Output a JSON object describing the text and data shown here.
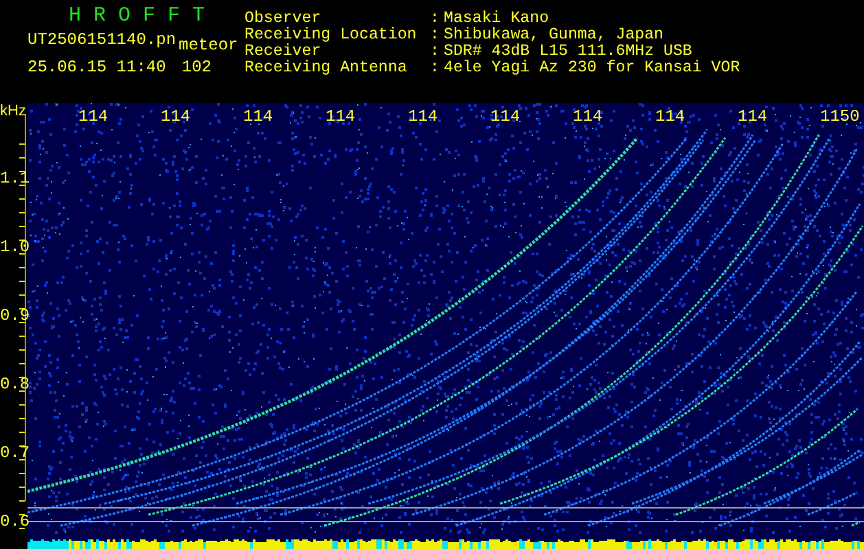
{
  "header": {
    "title": "H R O F F T",
    "filename": "UT2506151140.pn",
    "kind_label": "meteor",
    "timestamp": "25.06.15 11:40",
    "count": "102"
  },
  "info": [
    {
      "label": "Observer",
      "value": "Masaki Kano"
    },
    {
      "label": "Receiving Location",
      "value": "Shibukawa, Gunma, Japan"
    },
    {
      "label": "Receiver",
      "value": "SDR# 43dB L15 111.6MHz USB"
    },
    {
      "label": "Receiving Antenna",
      "value": "4ele Yagi Az 230 for Kansai VOR"
    }
  ],
  "separator": ":",
  "spectrogram": {
    "unit": "kHz",
    "x_labels": [
      "114",
      "114",
      "114",
      "114",
      "114",
      "114",
      "114",
      "114",
      "114",
      "1150"
    ],
    "y_labels": [
      "1.1",
      "1.0",
      "0.9",
      "0.8",
      "0.7",
      "0.6"
    ]
  }
}
